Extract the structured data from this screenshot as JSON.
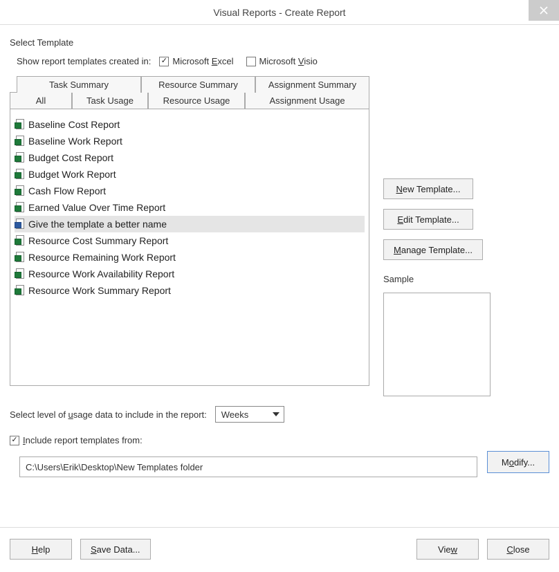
{
  "window": {
    "title": "Visual Reports - Create Report"
  },
  "section": {
    "select_template": "Select Template",
    "show_templates_label": "Show report templates created in:",
    "excel_pre": "Microsoft ",
    "excel_u": "E",
    "excel_post": "xcel",
    "visio_pre": "Microsoft ",
    "visio_u": "V",
    "visio_post": "isio"
  },
  "tabs_top": [
    {
      "label": "Task Summary"
    },
    {
      "label": "Resource Summary"
    },
    {
      "label": "Assignment Summary"
    }
  ],
  "tabs_bottom": [
    {
      "label": "All",
      "active": true
    },
    {
      "label": "Task Usage"
    },
    {
      "label": "Resource Usage"
    },
    {
      "label": "Assignment Usage"
    }
  ],
  "templates": [
    {
      "name": "Baseline Cost Report",
      "icon": "excel"
    },
    {
      "name": "Baseline Work Report",
      "icon": "excel"
    },
    {
      "name": "Budget Cost Report",
      "icon": "excel"
    },
    {
      "name": "Budget Work Report",
      "icon": "excel"
    },
    {
      "name": "Cash Flow Report",
      "icon": "excel"
    },
    {
      "name": "Earned Value Over Time Report",
      "icon": "excel"
    },
    {
      "name": "Give the template a better name",
      "icon": "visio",
      "selected": true
    },
    {
      "name": "Resource Cost Summary Report",
      "icon": "excel"
    },
    {
      "name": "Resource Remaining Work Report",
      "icon": "excel"
    },
    {
      "name": "Resource Work Availability Report",
      "icon": "excel"
    },
    {
      "name": "Resource Work Summary Report",
      "icon": "excel"
    }
  ],
  "side": {
    "new_u": "N",
    "new_post": "ew Template...",
    "edit_u": "E",
    "edit_post": "dit Template...",
    "manage_u": "M",
    "manage_post": "anage Template...",
    "sample_label": "Sample"
  },
  "usage": {
    "pre": "Select level of ",
    "u": "u",
    "post": "sage data to include in the report:",
    "selected": "Weeks"
  },
  "include": {
    "u": "I",
    "post": "nclude report templates from:",
    "path": "C:\\Users\\Erik\\Desktop\\New Templates folder"
  },
  "modify": {
    "pre": "M",
    "u": "o",
    "post": "dify..."
  },
  "footer": {
    "help_u": "H",
    "help_post": "elp",
    "save_u": "S",
    "save_post": "ave Data...",
    "view_pre": "Vie",
    "view_u": "w",
    "close_u": "C",
    "close_post": "lose"
  }
}
